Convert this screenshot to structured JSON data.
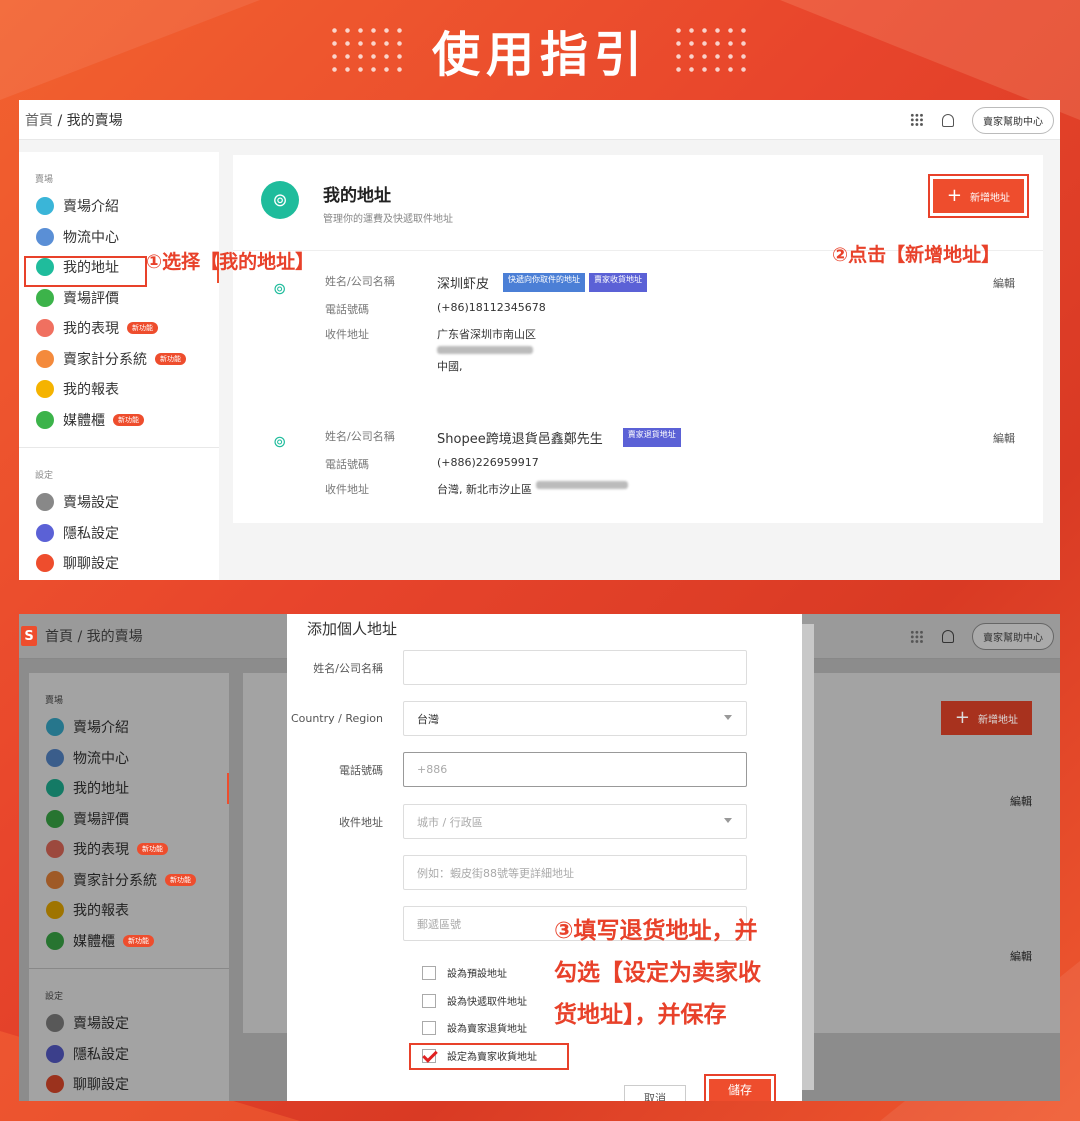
{
  "page_title": "使用指引",
  "colors": {
    "brand": "#ee4d2d",
    "accent_teal": "#1fbc9c",
    "annotation": "#e8412a"
  },
  "panel1": {
    "breadcrumb_home": "首頁",
    "breadcrumb_sep": " / ",
    "breadcrumb_current": "我的賣場",
    "help_button": "賣家幫助中心",
    "sidebar": {
      "section1": "賣場",
      "items": [
        {
          "label": "賣場介紹",
          "icon": "shop-intro-icon",
          "color": "#3ab5d8"
        },
        {
          "label": "物流中心",
          "icon": "truck-icon",
          "color": "#5a8fd6"
        },
        {
          "label": "我的地址",
          "icon": "location-pin-icon",
          "color": "#1fbc9c"
        },
        {
          "label": "賣場評價",
          "icon": "star-icon",
          "color": "#3cb34a"
        },
        {
          "label": "我的表現",
          "icon": "chart-icon",
          "color": "#f07060",
          "badge": "新功能"
        },
        {
          "label": "賣家計分系統",
          "icon": "lightning-icon",
          "color": "#f48a3c",
          "badge": "新功能"
        },
        {
          "label": "我的報表",
          "icon": "report-icon",
          "color": "#f5b300"
        },
        {
          "label": "媒體櫃",
          "icon": "media-icon",
          "color": "#3cb34a",
          "badge": "新功能"
        }
      ],
      "section2": "設定",
      "settings": [
        {
          "label": "賣場設定",
          "icon": "gear-icon",
          "color": "#888"
        },
        {
          "label": "隱私設定",
          "icon": "lock-icon",
          "color": "#5b61d6"
        },
        {
          "label": "聊聊設定",
          "icon": "chat-icon",
          "color": "#ee4d2d"
        }
      ]
    },
    "card": {
      "title": "我的地址",
      "subtitle": "管理你的運費及快遞取件地址",
      "new_address": "新增地址",
      "plus": "+",
      "addresses": [
        {
          "name_label": "姓名/公司名稱",
          "name": "深圳虾皮",
          "tags": [
            "快遞向你取件的地址",
            "賣家收貨地址"
          ],
          "phone_label": "電話號碼",
          "phone": "(+86)18112345678",
          "addr_label": "收件地址",
          "addr_line1": "广东省深圳市南山区",
          "addr_line3": "中國,",
          "edit": "編輯"
        },
        {
          "name_label": "姓名/公司名稱",
          "name": "Shopee跨境退貨邑鑫鄭先生",
          "tags": [
            "賣家退貨地址"
          ],
          "phone_label": "電話號碼",
          "phone": "(+886)226959917",
          "addr_label": "收件地址",
          "addr_line1": "台灣, 新北市汐止區",
          "edit": "編輯"
        }
      ]
    }
  },
  "annotations": {
    "step1": "①选择【我的地址】",
    "step2": "②点击【新增地址】",
    "step3_line1": "③填写退货地址，并",
    "step3_line2": "勾选【设定为卖家收",
    "step3_line3": "货地址】，并保存"
  },
  "panel2": {
    "logo": "S",
    "breadcrumb_home": "首頁",
    "breadcrumb_sep": " / ",
    "breadcrumb_current": "我的賣場",
    "help_button": "賣家幫助中心",
    "new_address": "新增地址",
    "edit": "編輯",
    "modal": {
      "title": "添加個人地址",
      "name_label": "姓名/公司名稱",
      "country_label": "Country / Region",
      "country_value": "台灣",
      "phone_label": "電話號碼",
      "phone_value": "+886",
      "addr_label": "收件地址",
      "city_placeholder": "城市 / 行政區",
      "detail_placeholder": "例如：蝦皮街88號等更詳細地址",
      "zip_placeholder": "郵遞區號",
      "checkboxes": [
        {
          "label": "設為預設地址",
          "checked": false
        },
        {
          "label": "設為快遞取件地址",
          "checked": false
        },
        {
          "label": "設為賣家退貨地址",
          "checked": false
        },
        {
          "label": "設定為賣家收貨地址",
          "checked": true
        }
      ],
      "cancel": "取消",
      "save": "儲存"
    }
  }
}
